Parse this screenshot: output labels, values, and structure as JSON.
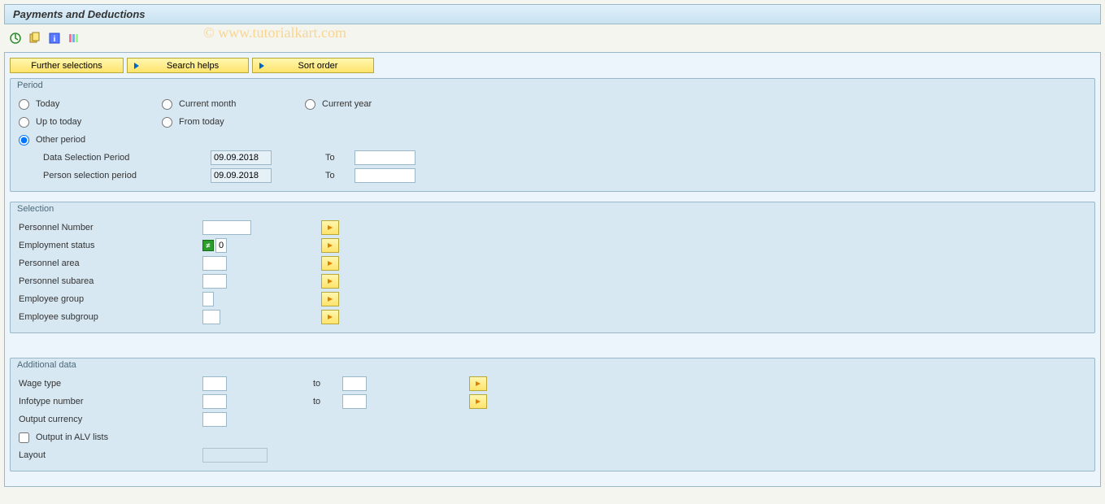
{
  "title": "Payments and Deductions",
  "watermark": "© www.tutorialkart.com",
  "toolbar_buttons": {
    "further_selections": "Further selections",
    "search_helps": "Search helps",
    "sort_order": "Sort order"
  },
  "groups": {
    "period": {
      "title": "Period",
      "radios": {
        "today": "Today",
        "current_month": "Current month",
        "current_year": "Current year",
        "up_to_today": "Up to today",
        "from_today": "From today",
        "other_period": "Other period"
      },
      "selected": "other_period",
      "fields": {
        "data_selection_period": {
          "label": "Data Selection Period",
          "from": "09.09.2018",
          "to_label": "To",
          "to": ""
        },
        "person_selection_period": {
          "label": "Person selection period",
          "from": "09.09.2018",
          "to_label": "To",
          "to": ""
        }
      }
    },
    "selection": {
      "title": "Selection",
      "fields": {
        "personnel_number": {
          "label": "Personnel Number",
          "value": ""
        },
        "employment_status": {
          "label": "Employment status",
          "value": "0",
          "exclude_indicator": "≠"
        },
        "personnel_area": {
          "label": "Personnel area",
          "value": ""
        },
        "personnel_subarea": {
          "label": "Personnel subarea",
          "value": ""
        },
        "employee_group": {
          "label": "Employee group",
          "value": ""
        },
        "employee_subgroup": {
          "label": "Employee subgroup",
          "value": ""
        }
      }
    },
    "additional": {
      "title": "Additional data",
      "fields": {
        "wage_type": {
          "label": "Wage type",
          "from": "",
          "to_label": "to",
          "to": ""
        },
        "infotype_number": {
          "label": "Infotype number",
          "from": "",
          "to_label": "to",
          "to": ""
        },
        "output_currency": {
          "label": "Output currency",
          "value": ""
        },
        "output_alv": {
          "label": "Output in ALV lists",
          "checked": false
        },
        "layout": {
          "label": "Layout",
          "value": ""
        }
      }
    }
  }
}
